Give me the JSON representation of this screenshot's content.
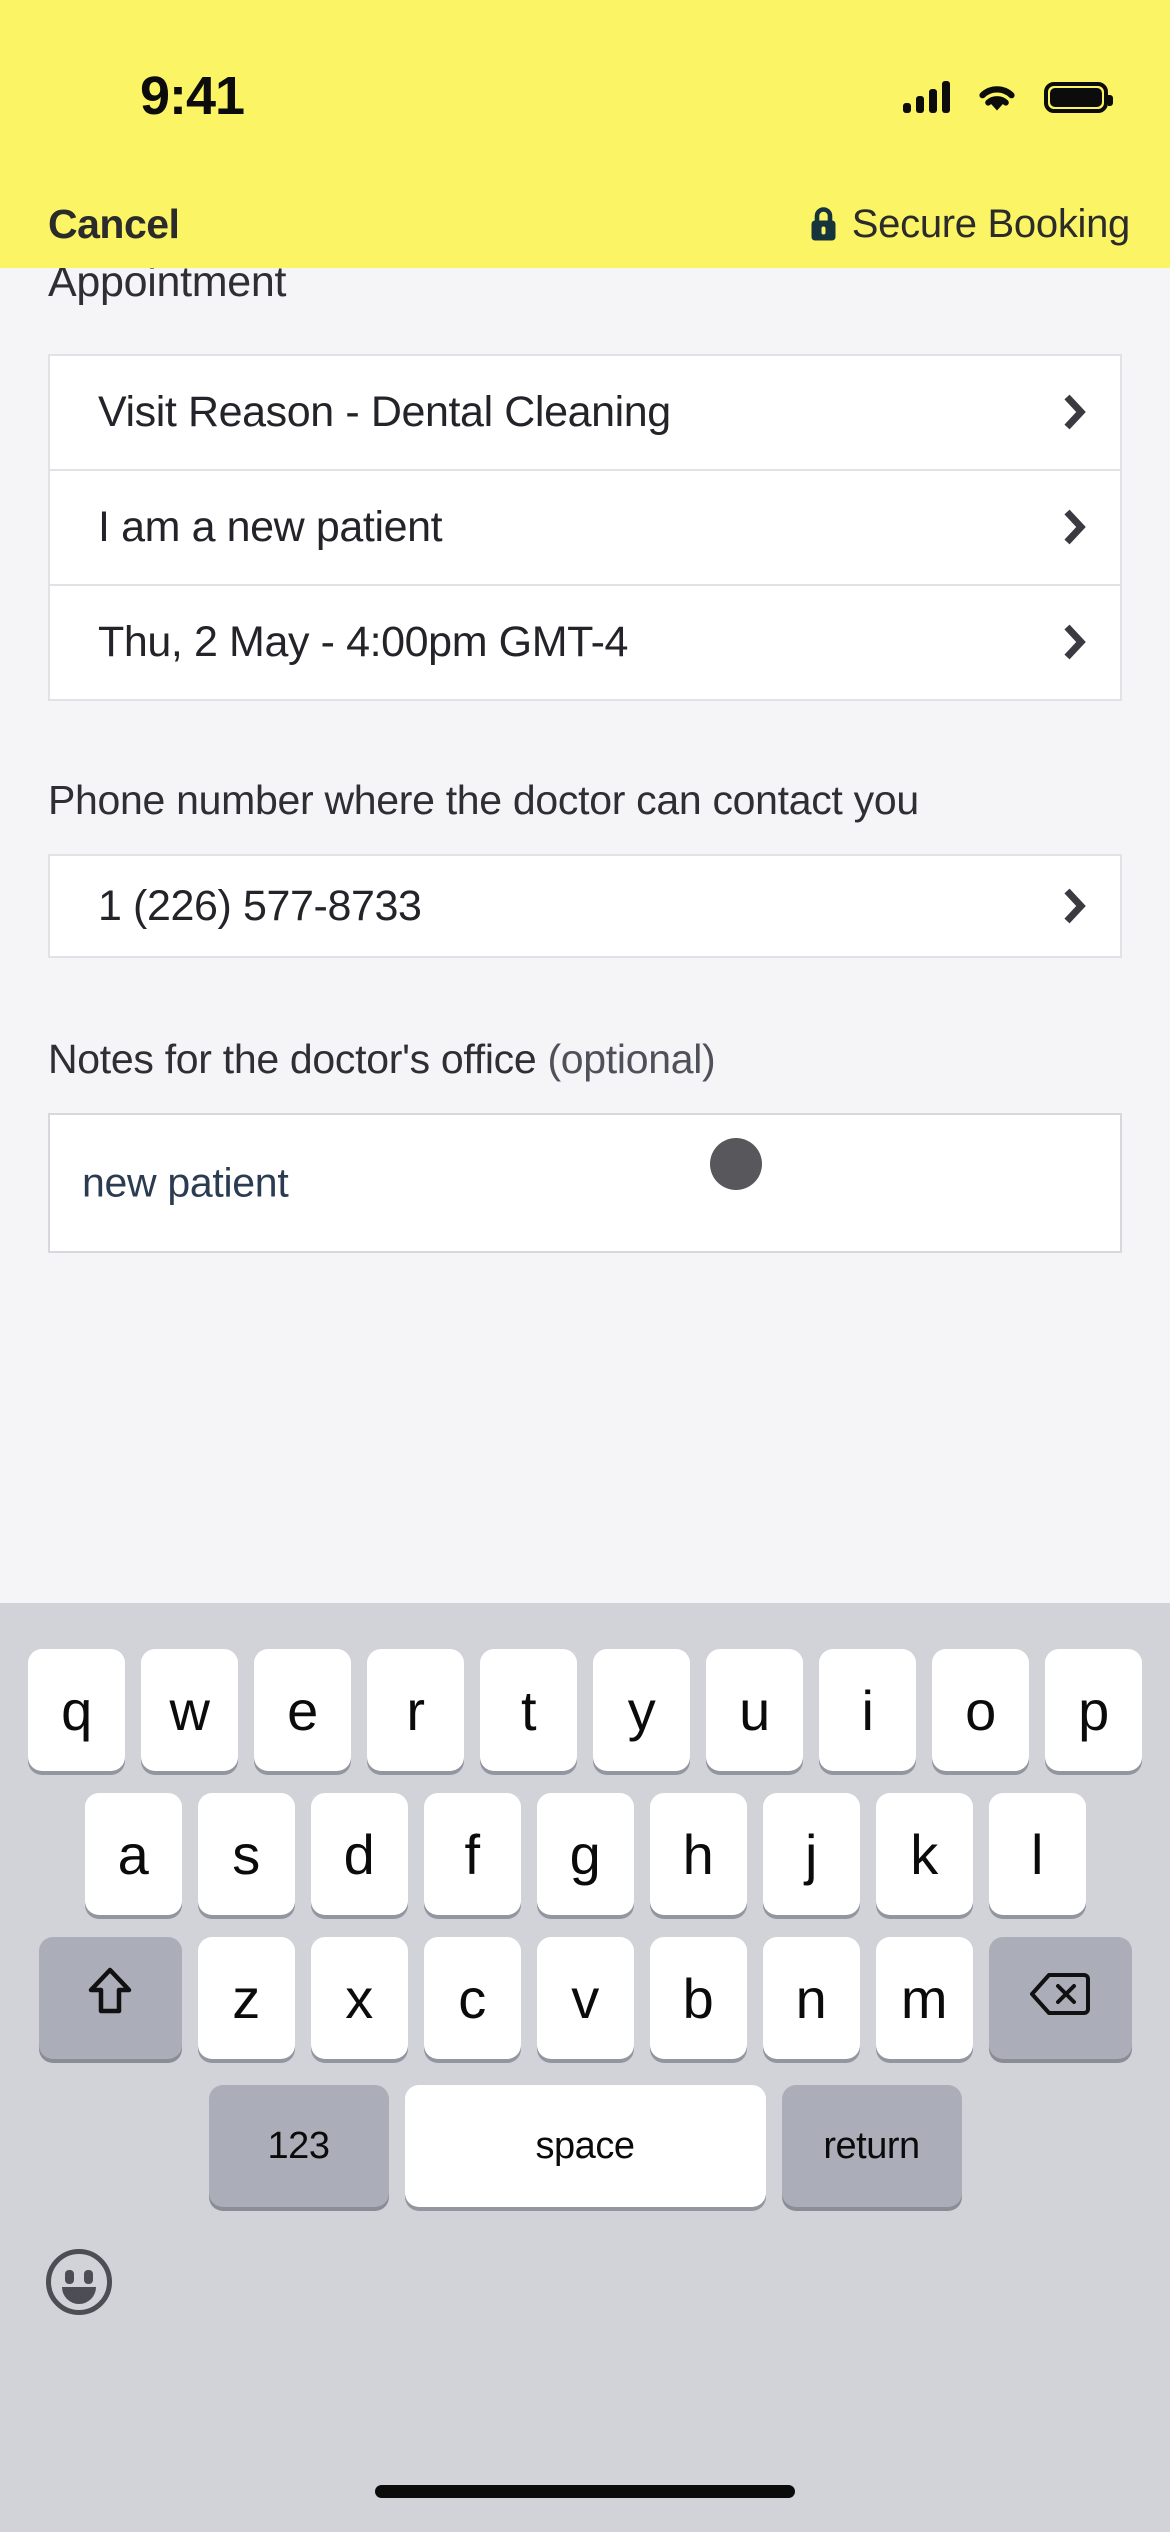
{
  "status_bar": {
    "time": "9:41",
    "icons": [
      "cellular-signal-icon",
      "wifi-icon",
      "battery-icon"
    ]
  },
  "nav_bar": {
    "cancel_label": "Cancel",
    "secure_label": "Secure Booking",
    "lock_icon": "lock-icon",
    "background_color": "#FBF565"
  },
  "content": {
    "section_title": "Appointment",
    "appointment_rows": [
      {
        "label": "Visit Reason - Dental Cleaning",
        "chevron": "chevron-right-icon"
      },
      {
        "label": "I am a new patient",
        "chevron": "chevron-right-icon"
      },
      {
        "label": "Thu, 2 May - 4:00pm GMT-4",
        "chevron": "chevron-right-icon"
      }
    ],
    "phone_section": {
      "label": "Phone number where the doctor can contact you",
      "value": "1 (226) 577-8733",
      "chevron": "chevron-right-icon"
    },
    "notes_section": {
      "label_main": "Notes for the doctor's office",
      "label_optional": "(optional)",
      "value": "new patient",
      "placeholder": "new patient",
      "text_color": "#2a3b52"
    },
    "touch_indicator": "touch-point-indicator"
  },
  "keyboard": {
    "row1": [
      "q",
      "w",
      "e",
      "r",
      "t",
      "y",
      "u",
      "i",
      "o",
      "p"
    ],
    "row2": [
      "a",
      "s",
      "d",
      "f",
      "g",
      "h",
      "j",
      "k",
      "l"
    ],
    "row3_letters": [
      "z",
      "x",
      "c",
      "v",
      "b",
      "n",
      "m"
    ],
    "shift_icon": "shift-arrow-icon",
    "backspace_icon": "backspace-icon",
    "numbers_label": "123",
    "space_label": "space",
    "return_label": "return",
    "emoji_icon": "emoji-smiley-icon",
    "background_color": "#D2D3D9",
    "key_color": "#FFFFFF",
    "modifier_key_color": "#ABAEB8"
  },
  "home_indicator": "home-indicator"
}
